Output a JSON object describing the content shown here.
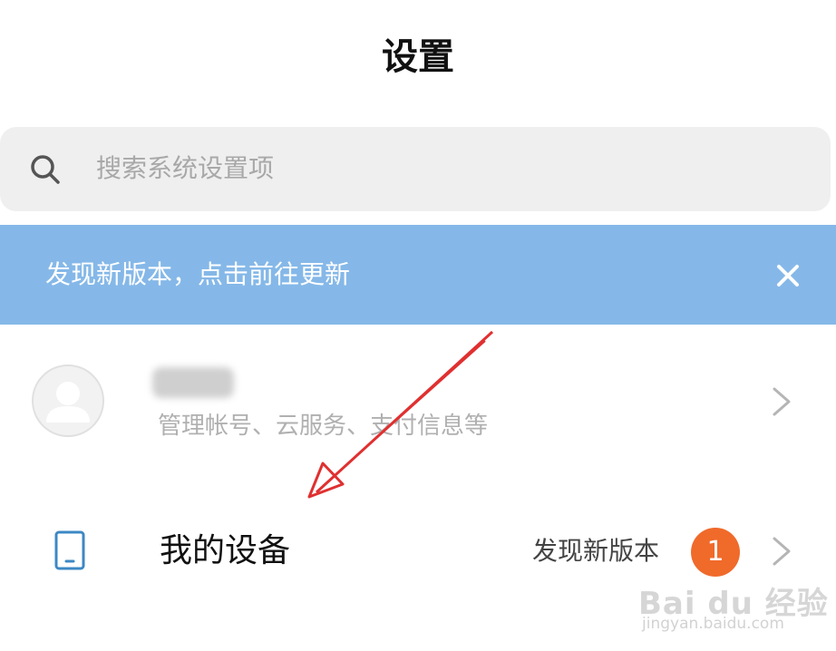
{
  "header": {
    "title": "设置"
  },
  "search": {
    "placeholder": "搜索系统设置项",
    "icon": "search-icon"
  },
  "banner": {
    "text": "发现新版本，点击前往更新",
    "close_icon": "close-icon",
    "color": "#85b8e8"
  },
  "account": {
    "description": "管理帐号、云服务、支付信息等",
    "avatar_icon": "avatar-placeholder-icon"
  },
  "device": {
    "label": "我的设备",
    "status": "发现新版本",
    "badge_count": "1",
    "badge_color": "#f06a2a"
  },
  "watermark": {
    "logo": "Bai du 经验",
    "url": "jingyan.baidu.com"
  }
}
